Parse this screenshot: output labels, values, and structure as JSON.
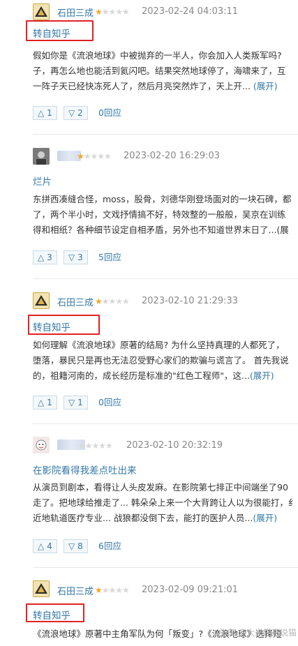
{
  "reviews": [
    {
      "user": "石田三成",
      "avatar": "pyramid-avatar",
      "rating_stars": 1,
      "max_stars": 5,
      "time": "2023-02-24 04:03:11",
      "title": "转自知乎",
      "lines": [
        "假如你是《流浪地球》中被抛弃的一半人，你会加入人类叛军吗?",
        "子，再怎么地也能活到氦闪吧。结果突然地球停了，海啸来了，互",
        "一阵子天已经快冻死人了，然后月亮突然炸了，天上开..."
      ],
      "expand": "(展开)",
      "up": "1",
      "down": "2",
      "replies": "0回应"
    },
    {
      "user": "",
      "avatar": "face-avatar",
      "rating_stars": 1,
      "max_stars": 5,
      "time": "2023-02-20 16:29:03",
      "title": "烂片",
      "lines": [
        "东拼西凑缝合怪，moss，股骨，刘德华刚登场面对的一块石碑，都",
        "了，两个半小时，文戏抒情搞不好，特效整的一般般，吴京在训练",
        "得和相纸？各种细节设定自相矛盾，另外也不知道世界末日了...(展"
      ],
      "expand": "",
      "up": "3",
      "down": "3",
      "replies": "5回应"
    },
    {
      "user": "石田三成",
      "avatar": "pyramid-avatar",
      "rating_stars": 1,
      "max_stars": 5,
      "time": "2023-02-10 21:29:33",
      "title": "转自知乎",
      "lines": [
        "如何理解《流浪地球》原著的结局? 为什么坚持真理的人都死了，",
        "堕落，暴民只是再也无法忍受野心家们的欺骗与谎言了。 首先我说",
        "的，祖籍河南的，成长经历是标准的\"红色工程师\"，这..."
      ],
      "expand": "(展开)",
      "up": "1",
      "down": "1",
      "replies": "0回应"
    },
    {
      "user": "",
      "avatar": "cartoon-avatar",
      "rating_stars": 0,
      "max_stars": 5,
      "time": "2023-02-10 20:32:19",
      "title": "在影院看得我差点吐出来",
      "lines": [
        "从演员到剧本，看得让人头皮发麻。在影院第七排正中间端坐了90",
        "走了。把地球给推走了... 韩朵朵上来一个大背跨让人以为很能打，纟",
        "近地轨道医疗专业... 战狼都没倒下去，能打的医护人员..."
      ],
      "expand": "(展开)",
      "up": "4",
      "down": "8",
      "replies": "6回应"
    },
    {
      "user": "石田三成",
      "avatar": "pyramid-avatar",
      "rating_stars": 1,
      "max_stars": 5,
      "time": "2023-02-09 09:21:01",
      "title": "转自知乎",
      "lines": [
        "《流浪地球》原著中主角军队为何「叛变」?《流浪地球》选择短"
      ],
      "expand": "",
      "up": "",
      "down": "",
      "replies": ""
    }
  ],
  "vote_up_icon": "△",
  "vote_down_icon": "▽",
  "watermark": "头条 @大米猫来说猫"
}
